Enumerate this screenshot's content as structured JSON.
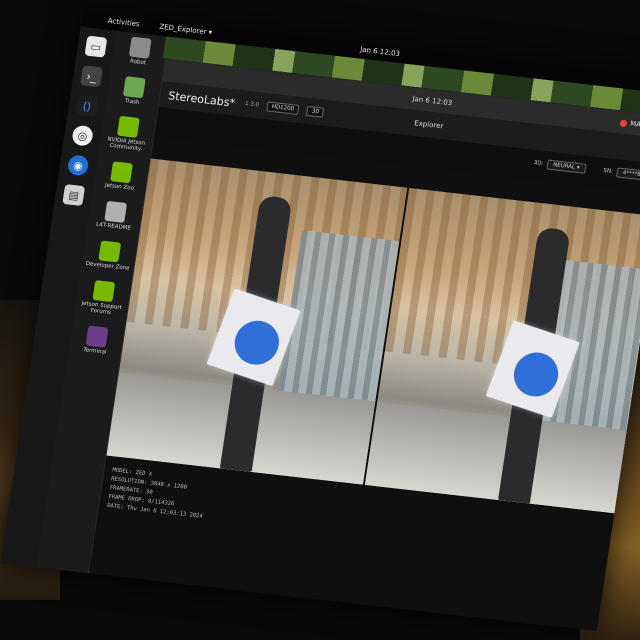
{
  "topbar": {
    "activities": "Activities",
    "app_menu": "ZED_Explorer ▾",
    "clock": "Jan 6 12:03"
  },
  "desktop_icons": [
    {
      "label": "Robot",
      "color": "#8c8c8c"
    },
    {
      "label": "Trash",
      "color": "#6aa84f"
    },
    {
      "label": "NVIDIA Jetson Community",
      "color": "#76b900"
    },
    {
      "label": "Jetson Zoo",
      "color": "#76b900"
    },
    {
      "label": "L4T-README",
      "color": "#b0b0b0"
    },
    {
      "label": "Developer Zone",
      "color": "#76b900"
    },
    {
      "label": "Jetson Support Forums",
      "color": "#76b900"
    },
    {
      "label": "Terminal",
      "color": "#6b3f8a"
    }
  ],
  "window": {
    "clock": "Jan 6 12:03",
    "user": "MAXN"
  },
  "app": {
    "brand": "StereoLabs*",
    "version": "1.3.0",
    "resolution_select": "HD1200",
    "fps_select": "30",
    "title": "Explorer",
    "depth_label": "3D:",
    "depth_select": "NEURAL ▾",
    "sn_label": "SN:",
    "sn_value": "4****826"
  },
  "info": {
    "model": "MODEL: ZED X",
    "resolution": "RESOLUTION: 3840 x 1200",
    "framerate": "FRAMERATE: 30",
    "frame_drop": "FRAME DROP: 0/114326",
    "date": "DATE: Thu Jan 6 12:03:13 2024"
  }
}
